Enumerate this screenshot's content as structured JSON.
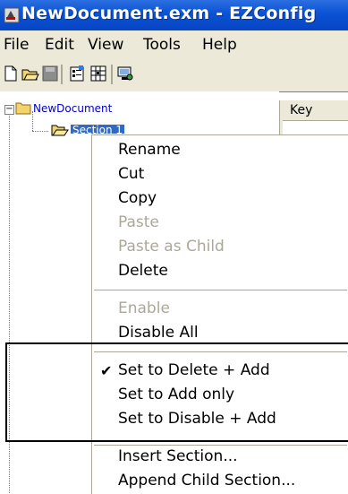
{
  "window": {
    "title": "NewDocument.exm - EZConfig"
  },
  "menubar": {
    "items": [
      "File",
      "Edit",
      "View",
      "Tools",
      "Help"
    ]
  },
  "toolbar": {
    "buttons": [
      "new-document-icon",
      "open-folder-icon",
      "save-icon",
      "properties-icon",
      "grid-icon",
      "network-icon"
    ]
  },
  "tree": {
    "root_label": "NewDocument",
    "selected_label": "Section 1"
  },
  "right_pane": {
    "column_header": "Key"
  },
  "context_menu": {
    "items": [
      {
        "label": "Rename",
        "enabled": true
      },
      {
        "label": "Cut",
        "enabled": true
      },
      {
        "label": "Copy",
        "enabled": true
      },
      {
        "label": "Paste",
        "enabled": false
      },
      {
        "label": "Paste as Child",
        "enabled": false
      },
      {
        "label": "Delete",
        "enabled": true
      },
      {
        "label": "Enable",
        "enabled": false
      },
      {
        "label": "Disable All",
        "enabled": true
      },
      {
        "label": "Set to Delete + Add",
        "enabled": true,
        "checked": true
      },
      {
        "label": "Set to Add only",
        "enabled": true
      },
      {
        "label": "Set to Disable + Add",
        "enabled": true
      },
      {
        "label": "Insert Section...",
        "enabled": true
      },
      {
        "label": "Append Child Section...",
        "enabled": true
      }
    ]
  },
  "colors": {
    "titlebar": "#0a52d4",
    "selection": "#316ac5",
    "disabled_text": "#aca899"
  }
}
